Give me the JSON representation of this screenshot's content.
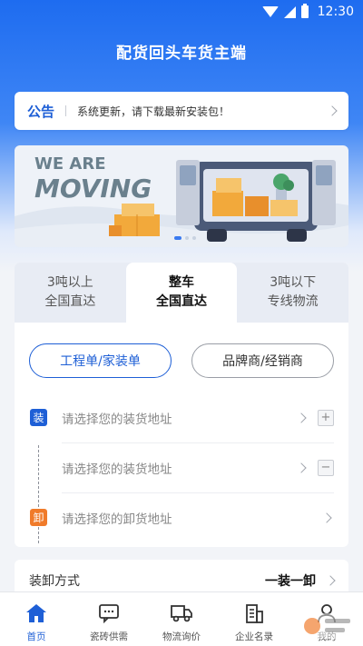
{
  "status_bar": {
    "time": "12:30"
  },
  "app": {
    "title": "配货回头车货主端"
  },
  "notice": {
    "tag": "公告",
    "text": "系统更新，请下载最新安装包！"
  },
  "banner": {
    "line1": "WE ARE",
    "line2": "MOVING"
  },
  "tabs": [
    {
      "line1": "3吨以上",
      "line2": "全国直达"
    },
    {
      "line1": "整车",
      "line2": "全国直达"
    },
    {
      "line1": "3吨以下",
      "line2": "专线物流"
    }
  ],
  "order_types": {
    "first": "工程单/家装单",
    "second": "品牌商/经销商"
  },
  "addresses": {
    "load_badge": "装",
    "unload_badge": "卸",
    "rows": [
      {
        "placeholder": "请选择您的装货地址",
        "action": "+"
      },
      {
        "placeholder": "请选择您的装货地址",
        "action": "−"
      },
      {
        "placeholder": "请选择您的卸货地址"
      }
    ]
  },
  "loading_method": {
    "label": "装卸方式",
    "value": "一装一卸"
  },
  "tabbar": [
    {
      "label": "首页",
      "icon": "home-icon"
    },
    {
      "label": "瓷砖供需",
      "icon": "chat-icon"
    },
    {
      "label": "物流询价",
      "icon": "truck-icon"
    },
    {
      "label": "企业名录",
      "icon": "building-icon"
    },
    {
      "label": "我的",
      "icon": "user-icon"
    }
  ],
  "colors": {
    "primary": "#1e5fd6",
    "accent_orange": "#f07b2a",
    "background": "#f2f4f8"
  }
}
